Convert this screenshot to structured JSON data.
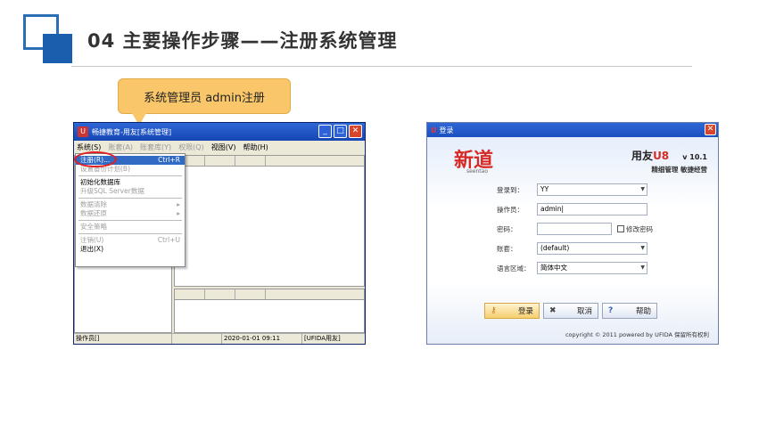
{
  "slide": {
    "title": "04  主要操作步骤——注册系统管理",
    "callout": "系统管理员 admin注册"
  },
  "admin_window": {
    "title": "畅捷教育-用友[系统管理]",
    "menu": [
      {
        "label": "系统(S)",
        "enabled": true
      },
      {
        "label": "账套(A)",
        "enabled": false
      },
      {
        "label": "账套库(Y)",
        "enabled": false
      },
      {
        "label": "权限(Q)",
        "enabled": false
      },
      {
        "label": "视图(V)",
        "enabled": true
      },
      {
        "label": "帮助(H)",
        "enabled": true
      }
    ],
    "dropdown": [
      {
        "label": "注册(R)...",
        "shortcut": "Ctrl+R",
        "state": "highlight"
      },
      {
        "label": "设置备份计划(B)",
        "shortcut": "",
        "state": "dim"
      },
      {
        "label": "初始化数据库",
        "shortcut": "",
        "state": "normal"
      },
      {
        "label": "升级SQL Server数据",
        "shortcut": "",
        "state": "dim"
      },
      {
        "label": "数据清除",
        "shortcut": "▸",
        "state": "dim"
      },
      {
        "label": "数据还原",
        "shortcut": "▸",
        "state": "dim"
      },
      {
        "label": "安全策略",
        "shortcut": "",
        "state": "dim"
      },
      {
        "label": "注销(U)",
        "shortcut": "Ctrl+U",
        "state": "dim"
      },
      {
        "label": "退出(X)",
        "shortcut": "",
        "state": "normal"
      }
    ],
    "status": [
      "操作员[]",
      "2020-01-01 09:11",
      "[UFIDA用友]"
    ]
  },
  "login_window": {
    "title": "登录",
    "brand_left": "新道",
    "brand_left_sub": "seentao",
    "brand_right": "用友",
    "brand_right_mark": "U8",
    "version": "v 10.1",
    "slogan": "精细管理 敏捷经营",
    "fields": {
      "server_label": "登录到：",
      "server_value": "YY",
      "user_label": "操作员：",
      "user_value": "admin",
      "password_label": "密码：",
      "password_value": "",
      "change_pwd": "修改密码",
      "account_label": "账套：",
      "account_value": "(default)",
      "lang_label": "语言区域：",
      "lang_value": "简体中文"
    },
    "buttons": {
      "login": "登录",
      "cancel": "取消",
      "help": "帮助"
    },
    "copyright": "copyright © 2011 powered by UFIDA 保留所有权利"
  }
}
